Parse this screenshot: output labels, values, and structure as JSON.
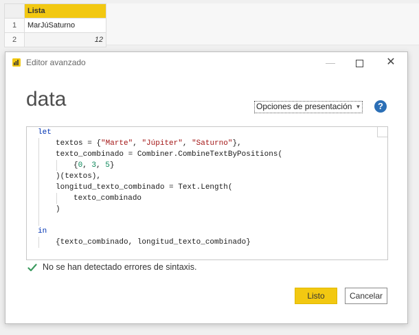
{
  "background_table": {
    "column_header": "Lista",
    "rows": [
      {
        "index": "1",
        "value": "MarJúSaturno"
      },
      {
        "index": "2",
        "value": "12"
      }
    ]
  },
  "dialog": {
    "title": "Editor avanzado",
    "query_name": "data",
    "options_label": "Opciones de presentación",
    "help_label": "?",
    "status_text": "No se han detectado errores de sintaxis.",
    "ok_label": "Listo",
    "cancel_label": "Cancelar"
  },
  "code": {
    "kw_let": "let",
    "l1_a": "textos = {",
    "l1_s1": "\"Marte\"",
    "l1_c1": ", ",
    "l1_s2": "\"Júpiter\"",
    "l1_c2": ", ",
    "l1_s3": "\"Saturno\"",
    "l1_b": "},",
    "l2": "texto_combinado = Combiner.CombineTextByPositions(",
    "l3_a": "{",
    "l3_n1": "0",
    "l3_c1": ", ",
    "l3_n2": "3",
    "l3_c2": ", ",
    "l3_n3": "5",
    "l3_b": "}",
    "l4": ")(textos),",
    "l5": "longitud_texto_combinado = Text.Length(",
    "l6": "texto_combinado",
    "l7": ")",
    "kw_in": "in",
    "l8": "{texto_combinado, longitud_texto_combinado}"
  },
  "colors": {
    "accent": "#f2c811",
    "help": "#2b6fb6",
    "success": "#3c9a5f",
    "keyword": "#0033b3",
    "string": "#a31515",
    "number": "#098658"
  },
  "icons": {
    "app": "power-bi-icon",
    "help": "help-icon",
    "status": "check-icon"
  }
}
